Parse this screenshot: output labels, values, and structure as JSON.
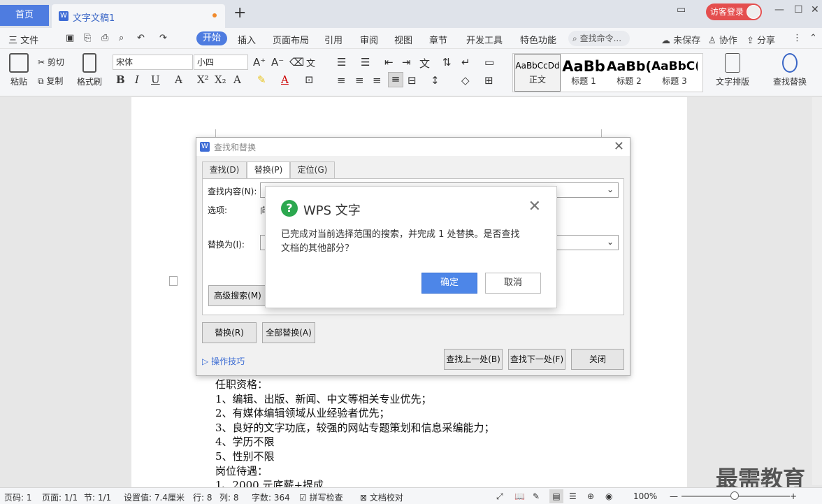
{
  "tabs": {
    "home_label": "首页",
    "doc_title": "文字文稿1",
    "doc_icon": "W",
    "add_icon": "+",
    "login_label": "访客登录"
  },
  "menu": {
    "file": "三 文件",
    "items": [
      "开始",
      "插入",
      "页面布局",
      "引用",
      "审阅",
      "视图",
      "章节",
      "开发工具",
      "特色功能"
    ],
    "search_placeholder": "查找命令...",
    "unsaved": "未保存",
    "collab": "协作",
    "share": "分享"
  },
  "ribbon": {
    "paste": "粘贴",
    "cut": "剪切",
    "copy": "复制",
    "format_painter": "格式刷",
    "font_name": "宋体",
    "font_size": "小四",
    "bold": "B",
    "italic": "I",
    "underline": "U",
    "styles": [
      {
        "preview": "AaBbCcDd",
        "name": "正文"
      },
      {
        "preview": "AaBb",
        "name": "标题 1"
      },
      {
        "preview": "AaBb(",
        "name": "标题 2"
      },
      {
        "preview": "AaBbC(",
        "name": "标题 3"
      }
    ],
    "text_layout": "文字排版",
    "find_replace": "查找替换"
  },
  "find_replace_dialog": {
    "title": "查找和替换",
    "tabs": [
      "查找(D)",
      "替换(P)",
      "定位(G)"
    ],
    "find_label": "查找内容(N):",
    "options_label": "选项:",
    "options_value": "向",
    "replace_label": "替换为(I):",
    "advanced_button": "高级搜索(M)",
    "replace_button": "替换(R)",
    "replace_all_button": "全部替换(A)",
    "tips_link": "操作技巧",
    "find_prev_button": "查找上一处(B)",
    "find_next_button": "查找下一处(F)",
    "close_button": "关闭"
  },
  "message_box": {
    "title": "WPS 文字",
    "message_line1": "已完成对当前选择范围的搜索，并完成 1 处替换。是否查找",
    "message_line2": "文档的其他部分？",
    "ok": "确定",
    "cancel": "取消"
  },
  "document": {
    "lines": [
      "任职资格：",
      "1、编辑、出版、新闻、中文等相关专业优先；",
      "2、有媒体编辑领域从业经验者优先；",
      "3、良好的文字功底，较强的网站专题策划和信息采编能力；",
      "4、学历不限",
      "5、性别不限",
      "岗位待遇：",
      "1、2000 元底薪+提成"
    ]
  },
  "statusbar": {
    "page_no": "页码: 1",
    "page": "页面: 1/1",
    "section": "节: 1/1",
    "setting": "设置值: 7.4厘米",
    "row": "行: 8",
    "col": "列: 8",
    "word_count": "字数: 364",
    "spell_check": "拼写检查",
    "doc_proof": "文档校对",
    "zoom": "100%",
    "zoom_level": 1.0
  },
  "watermark": "最需教育",
  "colors": {
    "accent": "#4e7ce0",
    "login": "#e44e4e",
    "ok_button": "#4d86e8",
    "question_icon": "#2ca84f"
  }
}
